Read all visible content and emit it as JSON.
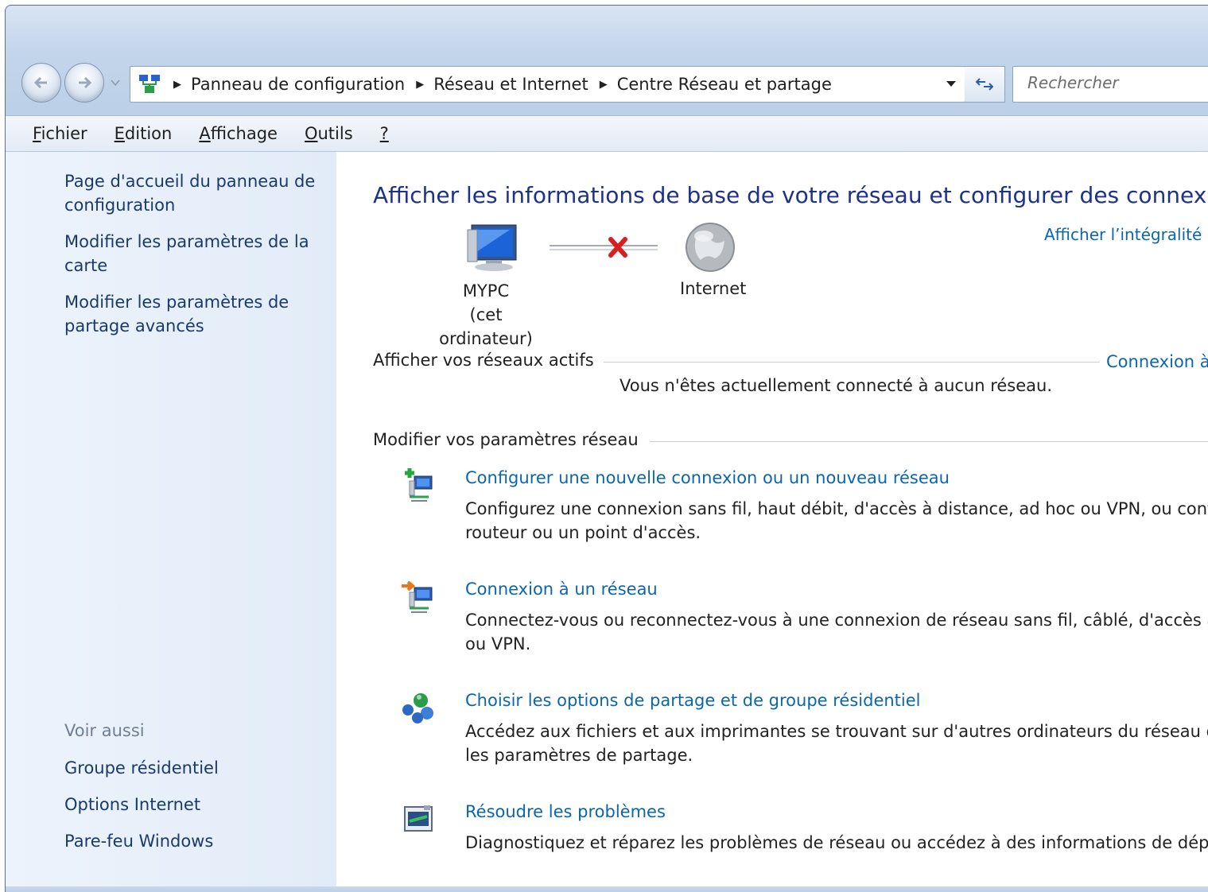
{
  "address_bar": {
    "breadcrumbs": [
      "Panneau de configuration",
      "Réseau et Internet",
      "Centre Réseau et partage"
    ],
    "search_placeholder": "Rechercher"
  },
  "menu": {
    "items": [
      {
        "accel": "F",
        "rest": "ichier"
      },
      {
        "accel": "E",
        "rest": "dition"
      },
      {
        "accel": "A",
        "rest": "ffichage"
      },
      {
        "accel": "O",
        "rest": "utils"
      },
      {
        "accel": "?",
        "rest": ""
      }
    ]
  },
  "sidebar": {
    "links": [
      "Page d'accueil du panneau de configuration",
      "Modifier les paramètres de la carte",
      "Modifier les paramètres de partage avancés"
    ],
    "see_also_heading": "Voir aussi",
    "see_also": [
      "Groupe résidentiel",
      "Options Internet",
      "Pare-feu Windows"
    ]
  },
  "main": {
    "title": "Afficher les informations de base de votre réseau et configurer des connexio",
    "full_map_link": "Afficher l’intégralité",
    "diagram": {
      "pc_name": "MYPC",
      "pc_sub": "(cet ordinateur)",
      "internet": "Internet"
    },
    "active_networks": {
      "heading": "Afficher vos réseaux actifs",
      "link": "Connexion à",
      "status": "Vous n'êtes actuellement connecté à aucun réseau."
    },
    "change_settings": {
      "heading": "Modifier vos paramètres réseau",
      "tasks": [
        {
          "icon": "new-connection-icon",
          "title": "Configurer une nouvelle connexion ou un nouveau réseau",
          "desc1": "Configurez une connexion sans fil, haut débit, d'accès à distance, ad hoc ou VPN, ou conf",
          "desc2": "routeur ou un point d'accès."
        },
        {
          "icon": "connect-network-icon",
          "title": "Connexion à un réseau",
          "desc1": "Connectez-vous ou reconnectez-vous à une connexion de réseau sans fil, câblé, d'accès à",
          "desc2": "ou VPN."
        },
        {
          "icon": "homegroup-sharing-icon",
          "title": "Choisir les options de partage et de groupe résidentiel",
          "desc1": "Accédez aux fichiers et aux imprimantes se trouvant sur d'autres ordinateurs du réseau ou",
          "desc2": "les paramètres de partage."
        },
        {
          "icon": "troubleshoot-icon",
          "title": "Résoudre les problèmes",
          "desc1": "Diagnostiquez et réparez les problèmes de réseau ou accédez à des informations de dépan",
          "desc2": ""
        }
      ]
    }
  }
}
